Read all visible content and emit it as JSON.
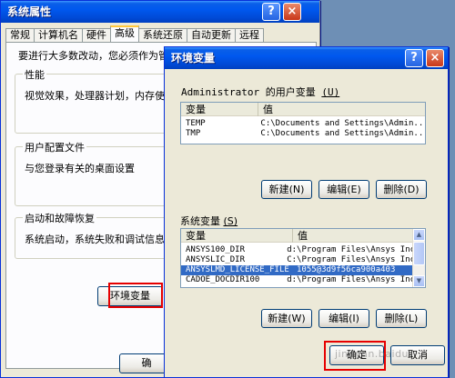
{
  "sysprops": {
    "title": "系统属性",
    "help_glyph": "?",
    "close_glyph": "×",
    "tabs": [
      "常规",
      "计算机名",
      "硬件",
      "高级",
      "系统还原",
      "自动更新",
      "远程"
    ],
    "intro_text": "要进行大多数改动，您必须作为管",
    "performance": {
      "title": "性能",
      "desc": "视觉效果，处理器计划，内存使用"
    },
    "user_profiles": {
      "title": "用户配置文件",
      "desc": "与您登录有关的桌面设置"
    },
    "startup_recovery": {
      "title": "启动和故障恢复",
      "desc": "系统启动，系统失败和调试信息"
    },
    "env_button": "环境变量",
    "ok_button": "确"
  },
  "envwin": {
    "title": "环境变量",
    "help_glyph": "?",
    "close_glyph": "×",
    "user_vars_label": "Administrator 的用户变量",
    "user_vars_hotkey": "(U)",
    "columns": {
      "name": "变量",
      "value": "值"
    },
    "user_vars": [
      {
        "name": "TEMP",
        "value": "C:\\Documents and Settings\\Admin..."
      },
      {
        "name": "TMP",
        "value": "C:\\Documents and Settings\\Admin..."
      }
    ],
    "user_buttons": {
      "new": "新建(N)",
      "edit": "编辑(E)",
      "delete": "删除(D)"
    },
    "sys_vars_label": "系统变量",
    "sys_vars_hotkey": "(S)",
    "sys_vars": [
      {
        "name": "ANSYS100_DIR",
        "value": "d:\\Program Files\\Ansys Inc\\v"
      },
      {
        "name": "ANSYSLIC_DIR",
        "value": "C:\\Program Files\\Ansys Inc\\S"
      },
      {
        "name": "ANSYSLMD_LICENSE_FILE",
        "value": "1055@3d9f56ca900a403"
      },
      {
        "name": "CADOE_DOCDIR100",
        "value": "d:\\Program Files\\Ansys Inc\\v"
      }
    ],
    "selected_row": 2,
    "sys_buttons": {
      "new": "新建(W)",
      "edit": "编辑(I)",
      "delete": "删除(L)"
    },
    "ok_button": "确定",
    "cancel_button": "取消"
  },
  "watermark": "jingyan.baidu",
  "colors": {
    "title_blue": "#0058ee",
    "selection": "#316ac5",
    "highlight_box": "#e60000"
  }
}
